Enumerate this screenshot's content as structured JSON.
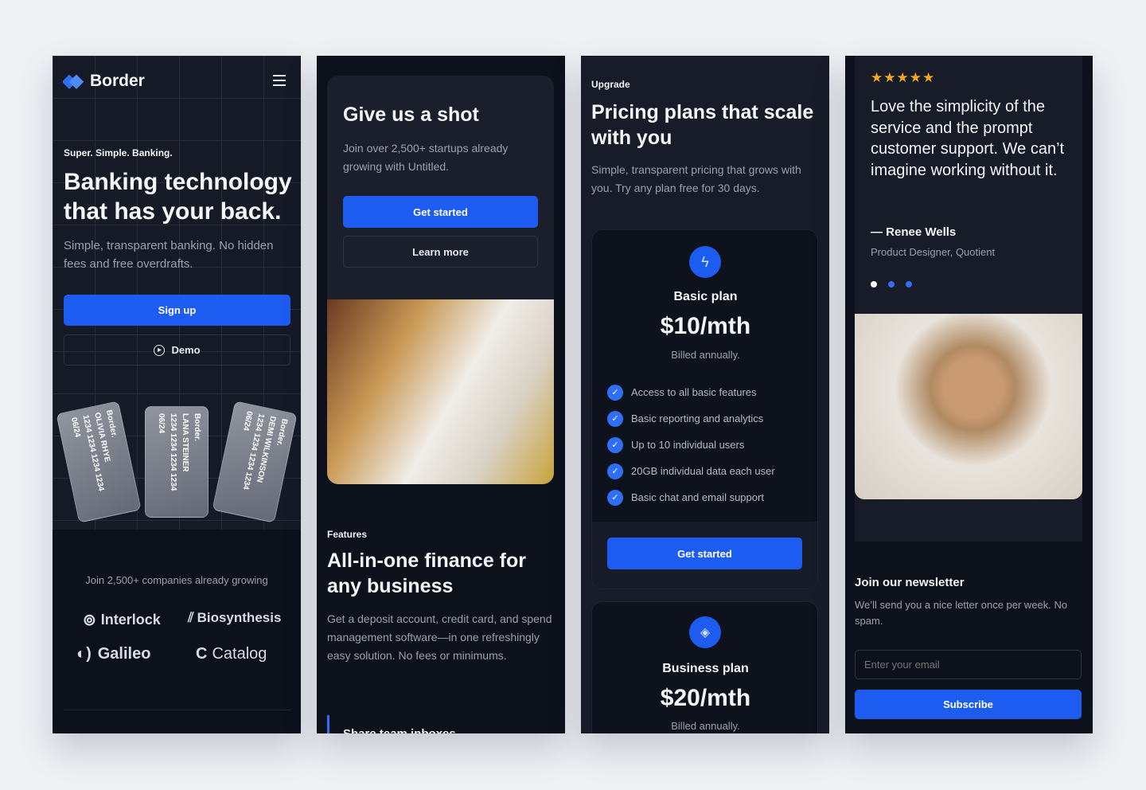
{
  "panel1": {
    "brand": "Border",
    "eyebrow": "Super. Simple. Banking.",
    "title": "Banking technology that has your back.",
    "subtitle": "Simple, transparent banking. No hidden fees and free overdrafts.",
    "signup": "Sign up",
    "demo": "Demo",
    "cards": [
      {
        "brand": "Border.",
        "name": "OLIVIA RHYE",
        "number": "1234 1234 1234 1234",
        "exp": "06/24"
      },
      {
        "brand": "Border.",
        "name": "LANA STEINER",
        "number": "1234 1234 1234 1234",
        "exp": "06/24"
      },
      {
        "brand": "Border.",
        "name": "DEMI WILKINSON",
        "number": "1234 1234 1234 1234",
        "exp": "06/24"
      }
    ],
    "social_proof": "Join 2,500+ companies already growing",
    "logos": [
      "Interlock",
      "Biosynthesis",
      "Galileo",
      "Catalog"
    ]
  },
  "panel2": {
    "title": "Give us a shot",
    "subtitle": "Join over 2,500+ startups already growing with Untitled.",
    "get_started": "Get started",
    "learn_more": "Learn more",
    "features_eyebrow": "Features",
    "features_title": "All-in-one finance for any business",
    "features_text": "Get a deposit account, credit card, and spend management software—in one refreshingly easy solution. No fees or minimums.",
    "feature_item": "Share team inboxes"
  },
  "panel3": {
    "eyebrow": "Upgrade",
    "title": "Pricing plans that scale with you",
    "subtitle": "Simple, transparent pricing that grows with you. Try any plan free for 30 days.",
    "plans": [
      {
        "icon": "zap-icon",
        "name": "Basic plan",
        "price": "$10/mth",
        "billing": "Billed annually.",
        "features": [
          "Access to all basic features",
          "Basic reporting and analytics",
          "Up to 10 individual users",
          "20GB individual data each user",
          "Basic chat and email support"
        ],
        "cta": "Get started"
      },
      {
        "icon": "layers-icon",
        "name": "Business plan",
        "price": "$20/mth",
        "billing": "Billed annually."
      }
    ]
  },
  "panel4": {
    "rating": 5,
    "quote": "Love the simplicity of the service and the prompt customer support. We can’t imagine working without it.",
    "author": "— Renee Wells",
    "role": "Product Designer, Quotient",
    "newsletter_title": "Join our newsletter",
    "newsletter_text": "We’ll send you a nice letter once per week. No spam.",
    "email_placeholder": "Enter your email",
    "subscribe": "Subscribe"
  },
  "colors": {
    "accent": "#1d5cf0",
    "star": "#f5a623",
    "panel_bg": "#161b27",
    "dark_bg": "#0d111c"
  }
}
